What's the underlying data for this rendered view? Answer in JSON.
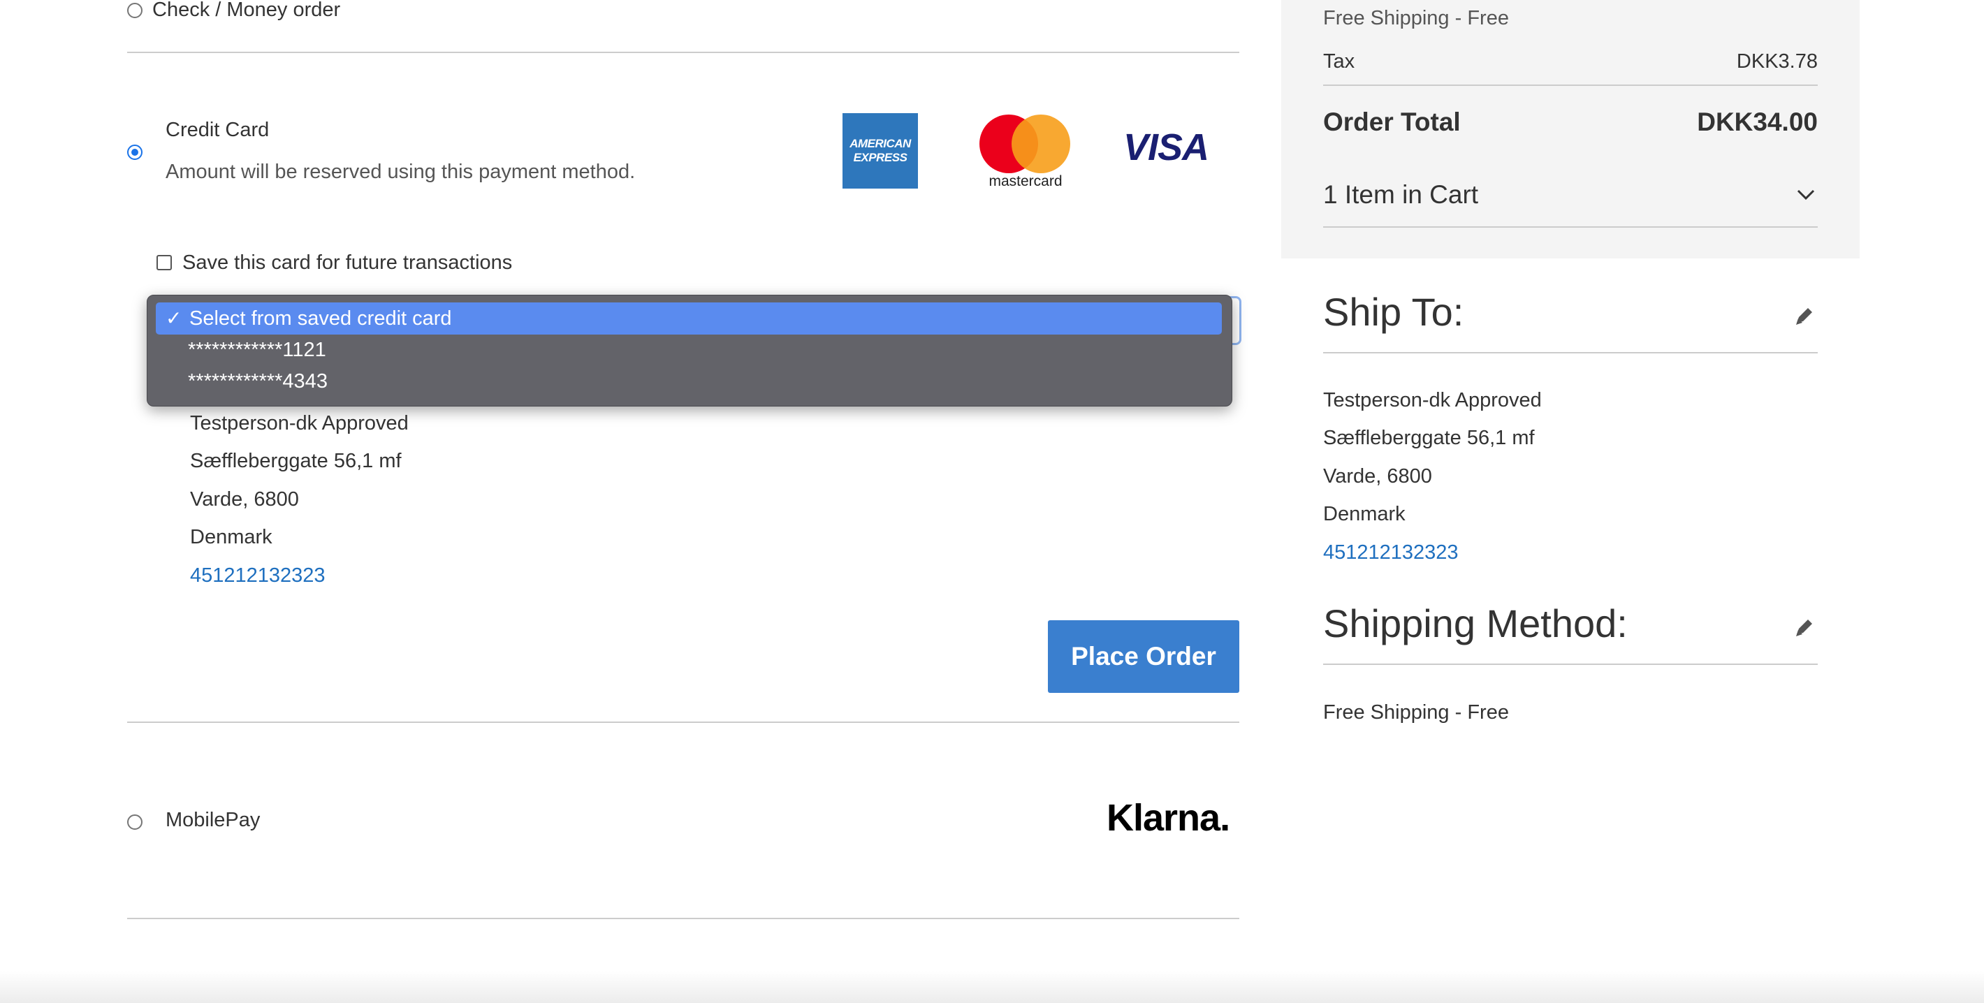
{
  "payment": {
    "check_label": "Check / Money order",
    "credit_card_label": "Credit Card",
    "credit_card_note": "Amount will be reserved using this payment method.",
    "save_card_label": "Save this card for future transactions",
    "saved_cards": {
      "options": [
        "Select from saved credit card",
        "************1121",
        "************4343"
      ],
      "selected_index": 0,
      "check_mark": "✓"
    },
    "logos": {
      "amex_line1": "AMERICAN",
      "amex_line2": "EXPRESS",
      "mastercard": "mastercard",
      "visa": "VISA",
      "klarna": "Klarna."
    },
    "billing_address": {
      "name": "Testperson-dk Approved",
      "street": "Sæffleberggate 56,1 mf",
      "city": "Varde, 6800",
      "country": "Denmark",
      "phone": "451212132323"
    },
    "place_order_label": "Place Order",
    "mobilepay_label": "MobilePay"
  },
  "summary": {
    "shipping_value": "Free Shipping - Free",
    "tax_label": "Tax",
    "tax_value": "DKK3.78",
    "order_total_label": "Order Total",
    "order_total_value": "DKK34.00",
    "items_in_cart": "1 Item in Cart"
  },
  "ship_to": {
    "title": "Ship To:",
    "name": "Testperson-dk Approved",
    "street": "Sæffleberggate 56,1 mf",
    "city": "Varde, 6800",
    "country": "Denmark",
    "phone": "451212132323"
  },
  "shipping_method": {
    "title": "Shipping Method:",
    "value": "Free Shipping - Free"
  },
  "colors": {
    "accent": "#3a7fcf",
    "link": "#1e6fbf",
    "dropdown_bg": "#636369",
    "dropdown_selected": "#5a8bef"
  }
}
